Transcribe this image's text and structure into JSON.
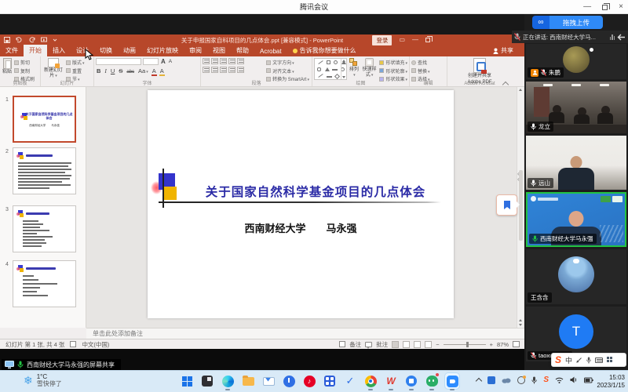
{
  "screen": {
    "title": "腾讯会议"
  },
  "meeting": {
    "upload_label": "拖拽上传",
    "upload_logo": "∞",
    "speaking": "正在讲话: 西南财经大学马...",
    "share_toast": "西南财经大学马永强的屏幕共享",
    "participants": [
      {
        "name": "朱鹏"
      },
      {
        "name": "龙立"
      },
      {
        "name": "远山"
      },
      {
        "name": "西南财经大学马永强"
      },
      {
        "name": "王含含"
      },
      {
        "name": "taoxueyang",
        "letter": "T"
      }
    ]
  },
  "ppt": {
    "window_title": "关于申报国家自科项目的几点体会.ppt [兼容模式] - PowerPoint",
    "login": "登录",
    "tabs": [
      "文件",
      "开始",
      "插入",
      "设计",
      "切换",
      "动画",
      "幻灯片放映",
      "审阅",
      "视图",
      "帮助",
      "Acrobat",
      "告诉我你想要做什么"
    ],
    "share": "共享",
    "ribbon": {
      "clipboard": {
        "label": "剪贴板",
        "paste": "粘贴",
        "items": [
          "剪切",
          "复制",
          "格式刷"
        ]
      },
      "slides": {
        "label": "幻灯片",
        "new_slide": "新建幻灯片",
        "items": [
          "版式",
          "重置",
          "节"
        ]
      },
      "font": {
        "label": "字体",
        "row": [
          "B",
          "I",
          "U",
          "S",
          "abc",
          "Aa",
          "A",
          "A"
        ]
      },
      "paragraph": {
        "label": "段落",
        "items": [
          "文字方向",
          "对齐文本",
          "转换为 SmartArt"
        ]
      },
      "drawing": {
        "label": "绘图",
        "arrange": "排列",
        "quick": "快速样式",
        "items": [
          "形状填充",
          "形状轮廓",
          "形状效果"
        ]
      },
      "editing": {
        "label": "编辑",
        "items": [
          "查找",
          "替换",
          "选择"
        ]
      },
      "acrobat": {
        "label": "Adobe Acrobat",
        "line1": "创建并共享",
        "line2": "Adobe PDF"
      }
    },
    "thumbnails": [
      "1",
      "2",
      "3",
      "4"
    ],
    "slide": {
      "title": "关于国家自然科学基金项目的几点体会",
      "subtitle": "西南财经大学　　马永强"
    },
    "notes_placeholder": "单击此处添加备注",
    "status": {
      "slide_info": "幻灯片 第 1 张, 共 4 张",
      "language": "中文(中国)",
      "notes": "备注",
      "comments": "批注",
      "zoom": "87%"
    }
  },
  "taskbar": {
    "weather_temp": "1°C",
    "weather_desc": "雪快停了",
    "time": "15:03",
    "date": "2023/1/15",
    "sogou": {
      "logo": "S",
      "lang": "中"
    }
  }
}
